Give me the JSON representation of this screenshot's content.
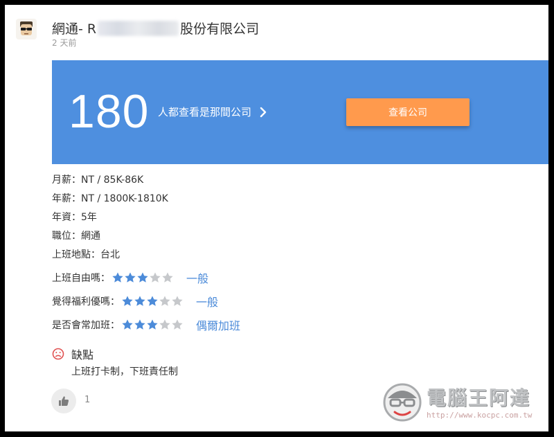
{
  "post": {
    "title_prefix": "網通- R",
    "title_suffix": "股份有限公司",
    "timestamp": "2 天前"
  },
  "banner": {
    "count": "180",
    "text": "人都查看是那間公司",
    "button_label": "查看公司",
    "color": "#4e8fdf",
    "button_color": "#ff9a4d"
  },
  "details": [
    "月薪：NT / 85K-86K",
    "年薪：NT / 1800K-1810K",
    "年資：5年",
    "職位：網通",
    "上班地點：台北"
  ],
  "ratings": [
    {
      "label": "上班自由嗎：",
      "stars": 3,
      "max": 5,
      "word": "一般"
    },
    {
      "label": "覺得福利優嗎：",
      "stars": 3,
      "max": 5,
      "word": "一般"
    },
    {
      "label": "是否會常加班：",
      "stars": 3,
      "max": 5,
      "word": "偶爾加班"
    }
  ],
  "cons": {
    "heading": "缺點",
    "text": "上班打卡制，下班責任制"
  },
  "likes": {
    "count": "1"
  },
  "watermark": {
    "text": "電腦王阿達",
    "url": "http://www.kocpc.com.tw"
  },
  "colors": {
    "star_filled": "#4c8bd9",
    "star_empty": "#c6c8cb",
    "link": "#4c8bd9"
  },
  "icons": [
    "avatar-sunglasses-icon",
    "chevron-right-icon",
    "star-icon",
    "sad-face-icon",
    "thumbs-up-icon"
  ]
}
